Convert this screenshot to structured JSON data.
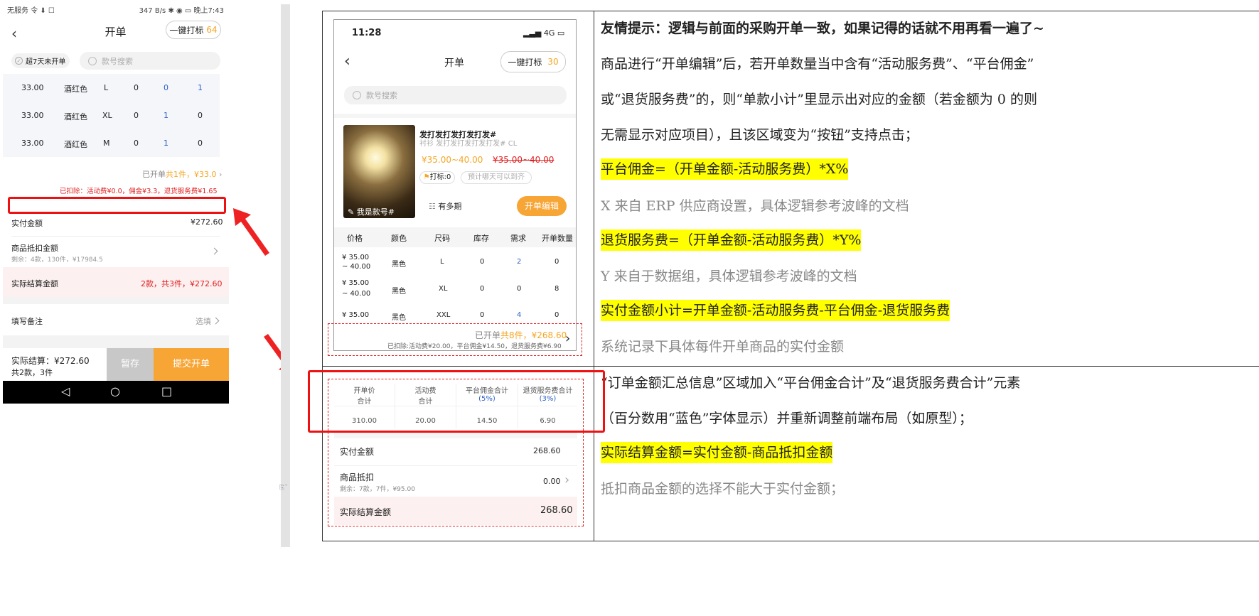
{
  "status_bar": {
    "left": "无服务 令 ⬇ ☐",
    "center": "347 B/s ✱ ◉ ▭ 晚上7:43"
  },
  "header": {
    "back": "‹",
    "title": "开单",
    "tag_btn": "一键打标",
    "tag_count": "64"
  },
  "filter": {
    "checkbox": "超7天未开单",
    "search_placeholder": "款号搜索"
  },
  "rows": [
    {
      "price": "33.00",
      "color": "酒红色",
      "size": "L",
      "c1": "0",
      "c2": "0",
      "c3": "1"
    },
    {
      "price": "33.00",
      "color": "酒红色",
      "size": "XL",
      "c1": "0",
      "c2": "1",
      "c3": "0"
    },
    {
      "price": "33.00",
      "color": "酒红色",
      "size": "M",
      "c1": "0",
      "c2": "1",
      "c3": "0"
    }
  ],
  "subtotal": {
    "prefix": "已开单",
    "count": "共1件，¥33.0",
    "deducted": "已扣除：活动费¥0.0，佣金¥3.3，退货服务费¥1.65"
  },
  "summary": {
    "paid_label": "实付金额",
    "paid_value": "¥272.60",
    "deduct_label": "商品抵扣金额",
    "deduct_sub": "剩余：4款，130件，¥17984.5",
    "settle_label": "实际结算金额",
    "settle_value": "2款，共3件，¥272.60",
    "remark_label": "填写备注",
    "remark_value": "选填"
  },
  "bottom": {
    "settle": "实际结算：¥272.60",
    "count": "共2款，3件",
    "save": "暂存",
    "submit": "提交开单"
  },
  "nav": {
    "back": "◁",
    "home": "○",
    "recent": "□"
  },
  "mock": {
    "time": "11:28",
    "signal": "4G",
    "title": "开单",
    "tag_btn": "一键打标",
    "tag_count": "30",
    "search": "款号搜索",
    "prod_name": "发打发打发打发打发#",
    "prod_name_gray": "衬衫  发打发打发打发打发#  CL",
    "price": "¥35.00~40.00",
    "orig_price": "¥35.00~40.00",
    "tag_label": "打标:0",
    "hint": "预计哪天可以到齐",
    "img_label": "我是款号#",
    "period": "有多期",
    "edit_btn": "开单编辑",
    "cols": [
      "价格",
      "颜色",
      "尺码",
      "库存",
      "需求",
      "开单数量"
    ],
    "rows": [
      {
        "p1": "¥ 35.00",
        "p2": "~ 40.00",
        "color": "黑色",
        "size": "L",
        "stock": "0",
        "need": "2",
        "qty": "0"
      },
      {
        "p1": "¥ 35.00",
        "p2": "~ 40.00",
        "color": "黑色",
        "size": "XL",
        "stock": "0",
        "need": "0",
        "qty": "8"
      },
      {
        "p1": "¥ 35.00",
        "p2": "",
        "color": "黑色",
        "size": "XXL",
        "stock": "0",
        "need": "4",
        "qty": "0"
      }
    ],
    "sub_prefix": "已开单",
    "sub_count": "共8件，¥268.60",
    "sub_deduct": "已扣除:活动费¥20.00，平台佣金¥14.50，退货服务费¥6.90",
    "sum_cols": [
      {
        "l1": "开单价",
        "l2": "合计",
        "val": "310.00"
      },
      {
        "l1": "活动费",
        "l2": "合计",
        "val": "20.00"
      },
      {
        "l1": "平台佣金合计",
        "l2": "(5%)",
        "val": "14.50"
      },
      {
        "l1": "退货服务费合计",
        "l2": "(3%)",
        "val": "6.90"
      }
    ],
    "paid_label": "实付金额",
    "paid_value": "268.60",
    "deduct_label": "商品抵扣",
    "deduct_sub": "剩余：7款，7件，¥95.00",
    "deduct_value": "0.00",
    "settle_label": "实际结算金额",
    "settle_value": "268.60"
  },
  "doc": {
    "p1": "友情提示：逻辑与前面的采购开单一致，如果记得的话就不用再看一遍了~",
    "p2": "商品进行“开单编辑”后，若开单数量当中含有“活动服务费”、“平台佣金”",
    "p3": "或“退货服务费”的，则“单款小计”里显示出对应的金额（若金额为 0 的则",
    "p4": "无需显示对应项目），且该区域变为“按钮”支持点击；",
    "p5": "平台佣金=（开单金额-活动服务费）*X%",
    "p6": "X 来自 ERP 供应商设置，具体逻辑参考波峰的文档",
    "p7": "退货服务费=（开单金额-活动服务费）*Y%",
    "p8": "Y 来自于数据组，具体逻辑参考波峰的文档",
    "p9": "实付金额小计=开单金额-活动服务费-平台佣金-退货服务费",
    "p10": "系统记录下具体每件开单商品的实付金额",
    "p11": "“订单金额汇总信息”区域加入“平台佣金合计”及“退货服务费合计”元素",
    "p12": "（百分数用“蓝色”字体显示）并重新调整前端布局（如原型）；",
    "p13": "实际结算金额=实付金额-商品抵扣金额",
    "p14": "抵扣商品金额的选择不能大于实付金额；"
  },
  "colors": {
    "orange": "#f5a623",
    "red": "#e02020",
    "blue": "#2c5fc4",
    "highlight": "#ffff00"
  }
}
